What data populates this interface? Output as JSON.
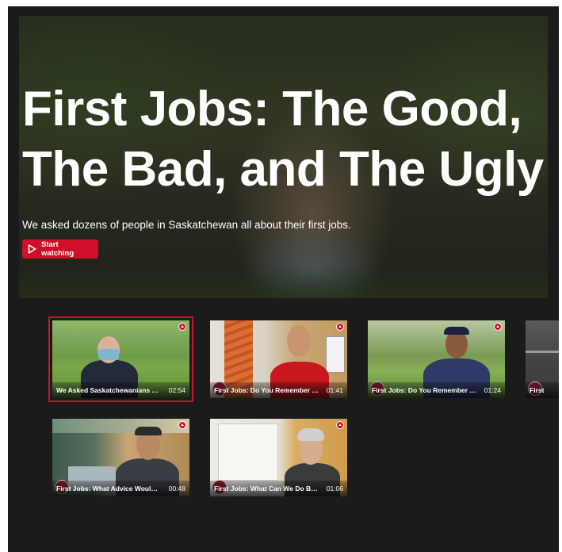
{
  "hero": {
    "title": "First Jobs: The Good,\nThe Bad, and The Ugly",
    "subtitle": "We asked dozens of people in Saskatchewan all about their first jobs.",
    "start_button_label": "Start watching",
    "start_icon": "play-outline-icon"
  },
  "videos": [
    {
      "title": "We Asked Saskatchewanians About Their First Jobs",
      "duration": "02:54",
      "selected": true
    },
    {
      "title": "First Jobs: Do You Remember Your First Job?",
      "duration": "01:41",
      "selected": false
    },
    {
      "title": "First Jobs: Do You Remember Your First Job?",
      "duration": "01:24",
      "selected": false
    },
    {
      "title": "First",
      "duration": "",
      "selected": false
    },
    {
      "title": "First Jobs: What Advice Would You Give?",
      "duration": "00:48",
      "selected": false
    },
    {
      "title": "First Jobs: What Can We Do Better?",
      "duration": "01:06",
      "selected": false
    }
  ],
  "colors": {
    "accent": "#d0102a",
    "background": "#1c1b1b"
  }
}
